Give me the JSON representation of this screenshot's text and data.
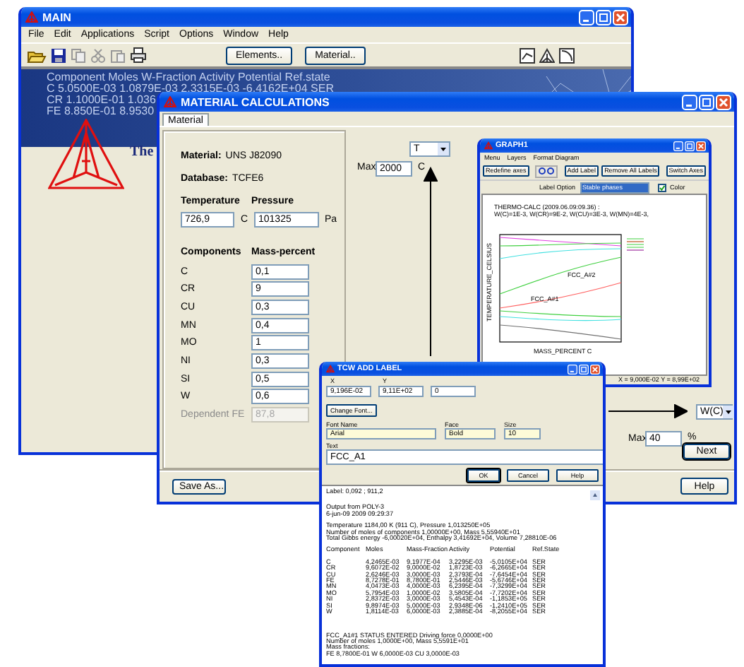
{
  "main_window": {
    "title": "MAIN",
    "menu": [
      "File",
      "Edit",
      "Applications",
      "Script",
      "Options",
      "Window",
      "Help"
    ],
    "toolbar_buttons": [
      "Elements..",
      "Material.."
    ],
    "banner_lines": [
      "Component Moles W-Fraction Activity Potential Ref.state",
      "C 5.0500E-03 1.0879E-03 2.3315E-03 -6.4162E+04 SER",
      "CR 1.1000E-01 1.036",
      "FE 8.850E-01 8.9530"
    ],
    "logo_text": "The"
  },
  "material_window": {
    "title": "MATERIAL CALCULATIONS",
    "tabs": [
      {
        "label": "Material",
        "selected": true
      }
    ],
    "material": {
      "label": "Material:",
      "value": "UNS J82090"
    },
    "database": {
      "label": "Database:",
      "value": "TCFE6"
    },
    "temperature": {
      "label": "Temperature",
      "value": "726,9",
      "unit": "C"
    },
    "pressure": {
      "label": "Pressure",
      "value": "101325",
      "unit": "Pa"
    },
    "components_heading": "Components",
    "mass_heading": "Mass-percent",
    "components": [
      {
        "name": "C",
        "value": "0,1",
        "disabled": false
      },
      {
        "name": "CR",
        "value": "9",
        "disabled": false
      },
      {
        "name": "CU",
        "value": "0,3",
        "disabled": false
      },
      {
        "name": "MN",
        "value": "0,4",
        "disabled": false
      },
      {
        "name": "MO",
        "value": "1",
        "disabled": false
      },
      {
        "name": "NI",
        "value": "0,3",
        "disabled": false
      },
      {
        "name": "SI",
        "value": "0,5",
        "disabled": false
      },
      {
        "name": "W",
        "value": "0,6",
        "disabled": false
      },
      {
        "name": "Dependent FE",
        "value": "87,8",
        "disabled": true
      }
    ],
    "y_axis": {
      "variable": "T",
      "max_label": "Max",
      "max": "2000",
      "unit": "C"
    },
    "x_axis": {
      "variable": "W(C)",
      "max_label": "Max",
      "max": "40",
      "unit": "%"
    },
    "next_button": "Next",
    "save_button": "Save As...",
    "help_button": "Help"
  },
  "graph_window": {
    "title": "GRAPH1",
    "menu": [
      "Menu",
      "Layers",
      "Format Diagram"
    ],
    "toolbar_buttons": [
      "Redefine axes",
      "Add Label",
      "Remove All Labels",
      "Switch Axes"
    ],
    "label_option": {
      "label": "Label Option",
      "value": "Stable phases"
    },
    "color_option": {
      "label": "Color",
      "checked": true
    },
    "heading_lines": [
      "THERMO-CALC (2009.06.09:09.36) :",
      "W(C)=1E-3, W(CR)=9E-2, W(CU)=3E-3, W(MN)=4E-3,"
    ],
    "phase_labels": [
      "FCC_A#2",
      "FCC_A#1"
    ],
    "xlabel": "MASS_PERCENT C",
    "ylabel": "TEMPERATURE_CELSIUS",
    "status": "X = 9,000E-02 Y = 8,99E+02"
  },
  "label_window": {
    "title": "TCW ADD LABEL",
    "x_label": "X",
    "x_value": "9,196E-02",
    "y_label": "Y",
    "y_value": "9,11E+02",
    "angle_value": "0",
    "change_font_button": "Change Font...",
    "font_name": {
      "label": "Font Name",
      "value": "Arial"
    },
    "face": {
      "label": "Face",
      "value": "Bold"
    },
    "size": {
      "label": "Size",
      "value": "10"
    },
    "text": {
      "label": "Text",
      "value": "FCC_A1"
    },
    "buttons": [
      "OK",
      "Cancel",
      "Help"
    ],
    "output_intro": [
      "Label: 0,092 ; 911,2",
      "Output from POLY-3",
      "6-jun-09 2009 09:29:37",
      "Temperature 1184,00 K (911 C), Pressure 1,013250E+05",
      "Number of moles of components 1,00000E+00, Mass 5,55940E+01",
      "Total Gibbs energy -6,00020E+04, Enthalpy 3,41692E+04, Volume 7,28810E-06"
    ],
    "output_columns": [
      "Component",
      "Moles",
      "Mass-Fraction",
      "Activity",
      "Potential",
      "Ref.State"
    ],
    "output_rows": [
      [
        "C",
        "4,2465E-03",
        "9,1977E-04",
        "3,2295E-03",
        "-5,0105E+04",
        "SER"
      ],
      [
        "CR",
        "9,6072E-02",
        "9,0000E-02",
        "1,8723E-03",
        "-6,2665E+04",
        "SER"
      ],
      [
        "CU",
        "2,6246E-03",
        "3,0000E-03",
        "2,3793E-04",
        "-7,6454E+04",
        "SER"
      ],
      [
        "FE",
        "8,7278E-01",
        "8,7800E-01",
        "2,5446E-03",
        "-5,6746E+04",
        "SER"
      ],
      [
        "MN",
        "4,0473E-03",
        "4,0000E-03",
        "6,2395E-04",
        "-7,3299E+04",
        "SER"
      ],
      [
        "MO",
        "5,7954E-03",
        "1,0000E-02",
        "3,5805E-04",
        "-7,7202E+04",
        "SER"
      ],
      [
        "NI",
        "2,8372E-03",
        "3,0000E-03",
        "5,4543E-04",
        "-1,1853E+05",
        "SER"
      ],
      [
        "SI",
        "9,8974E-03",
        "5,0000E-03",
        "2,9348E-06",
        "-1,2410E+05",
        "SER"
      ],
      [
        "W",
        "1,8114E-03",
        "6,0000E-03",
        "2,3885E-04",
        "-8,2055E+04",
        "SER"
      ]
    ],
    "output_outro": [
      "FCC_A1#1     STATUS ENTERED     Driving force 0,0000E+00",
      "Number of moles 1,0000E+00, Mass 5,5591E+01",
      "Mass fractions:",
      "FE 8,7800E-01  W 6,0000E-03  CU 3,0000E-03"
    ]
  }
}
